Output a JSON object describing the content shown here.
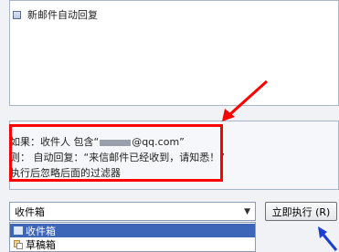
{
  "rules": {
    "items": [
      {
        "label": "新邮件自动回复"
      }
    ]
  },
  "description": {
    "line1_prefix": "如果：收件人 包含“",
    "line1_masked": "[redacted]",
    "line1_suffix": "@qq.com”",
    "line2": "则：  自动回复：“来信邮件已经收到，请知悉！”",
    "line3": "执行后忽略后面的过滤器"
  },
  "folder_select": {
    "value": "收件箱",
    "options": [
      {
        "label": "收件箱",
        "icon": "inbox-icon",
        "selected": true
      },
      {
        "label": "草稿箱",
        "icon": "drafts-icon",
        "selected": false
      }
    ]
  },
  "run_button": {
    "label": "立即执行 (R)"
  },
  "annotations": {
    "highlight_color": "#ff0000",
    "cursor_arrow_color": "#1a3fd6"
  }
}
